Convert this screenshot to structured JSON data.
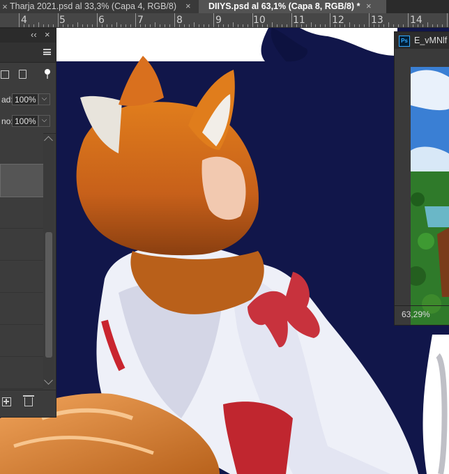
{
  "tabs": [
    {
      "label": "Tharja 2021.psd al 33,3% (Capa 4, RGB/8)",
      "close": "×"
    },
    {
      "label": "DIIYS.psd al 63,1% (Capa 8, RGB/8) *",
      "close": "×"
    }
  ],
  "ruler": {
    "labels": [
      "4",
      "5",
      "6",
      "7",
      "8",
      "9",
      "10",
      "11",
      "12",
      "13",
      "14"
    ]
  },
  "layers_panel": {
    "collapse_glyph": "‹‹",
    "close_glyph": "×",
    "row1_label": "ad:",
    "row1_value": "100%",
    "row2_label": "no:",
    "row2_value": "100%"
  },
  "navigator": {
    "title": "E_vMNlf",
    "app_badge": "Ps",
    "zoom": "63,29%"
  },
  "document_tab_close": "×",
  "colors": {
    "canvas_bg": "#11164a",
    "ui_dark": "#2b2b2b",
    "panel": "#3c3c3c"
  }
}
